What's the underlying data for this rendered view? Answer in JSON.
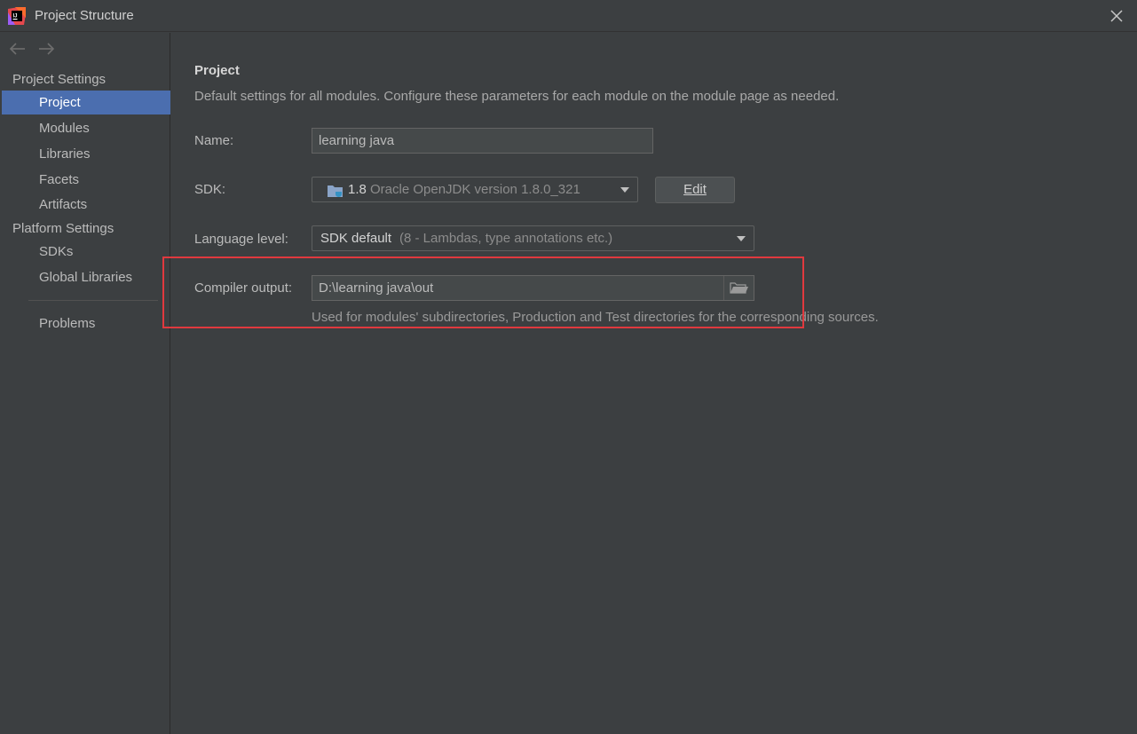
{
  "window": {
    "title": "Project Structure",
    "app_icon": "intellij-idea-icon",
    "close_icon": "close-icon"
  },
  "nav": {
    "back_icon": "arrow-left-icon",
    "forward_icon": "arrow-right-icon"
  },
  "sidebar": {
    "project_settings_header": "Project Settings",
    "project_items": [
      {
        "label": "Project",
        "selected": true
      },
      {
        "label": "Modules"
      },
      {
        "label": "Libraries"
      },
      {
        "label": "Facets"
      },
      {
        "label": "Artifacts"
      }
    ],
    "platform_settings_header": "Platform Settings",
    "platform_items": [
      {
        "label": "SDKs"
      },
      {
        "label": "Global Libraries"
      }
    ],
    "problems_label": "Problems"
  },
  "main": {
    "title": "Project",
    "description": "Default settings for all modules. Configure these parameters for each module on the module page as needed.",
    "name_label": "Name:",
    "name_value": "learning java",
    "sdk_label": "SDK:",
    "sdk_version": "1.8",
    "sdk_detail": "Oracle OpenJDK version 1.8.0_321",
    "sdk_icon": "jdk-folder-icon",
    "edit_button": "Edit",
    "language_level_label": "Language level:",
    "language_level_value": "SDK default",
    "language_level_detail": "(8 - Lambdas, type annotations etc.)",
    "compiler_output_label": "Compiler output:",
    "compiler_output_value": "D:\\learning java\\out",
    "compiler_output_hint": "Used for modules' subdirectories, Production and Test directories for the corresponding sources.",
    "browse_icon": "folder-open-icon"
  },
  "colors": {
    "background": "#3c3f41",
    "selection": "#4b6eaf",
    "highlight_box": "#e0393e"
  }
}
